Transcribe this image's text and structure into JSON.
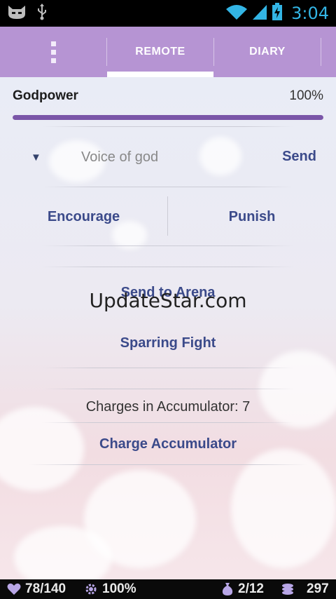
{
  "status_bar": {
    "left_icons": [
      "cat-face-icon",
      "usb-icon"
    ],
    "right_icons": [
      "wifi-icon",
      "signal-icon",
      "battery-charging-icon"
    ],
    "time": "3:04",
    "accent_color": "#33b5e5"
  },
  "action_bar": {
    "background_color": "#b694d3",
    "tabs": [
      {
        "label": "REMOTE",
        "active": true
      },
      {
        "label": "DIARY",
        "active": false
      }
    ]
  },
  "godpower": {
    "label": "Godpower",
    "value_text": "100%",
    "level": 1.0,
    "fill_color": "#7a56a8"
  },
  "voice": {
    "placeholder": "Voice of god",
    "value": "",
    "send_label": "Send"
  },
  "actions": {
    "encourage_label": "Encourage",
    "punish_label": "Punish",
    "send_to_arena_label": "Send to Arena",
    "sparring_fight_label": "Sparring Fight",
    "charges_text": "Charges in Accumulator: 7",
    "charge_accumulator_label": "Charge Accumulator",
    "button_text_color": "#3b4a8a"
  },
  "watermark": "UpdateStar.com",
  "bottom_bar": {
    "health": "78/140",
    "godpower": "100%",
    "inventory": "2/12",
    "gold": "297",
    "icons": [
      "heart-icon",
      "gear-icon",
      "money-bag-icon",
      "coins-icon"
    ]
  }
}
